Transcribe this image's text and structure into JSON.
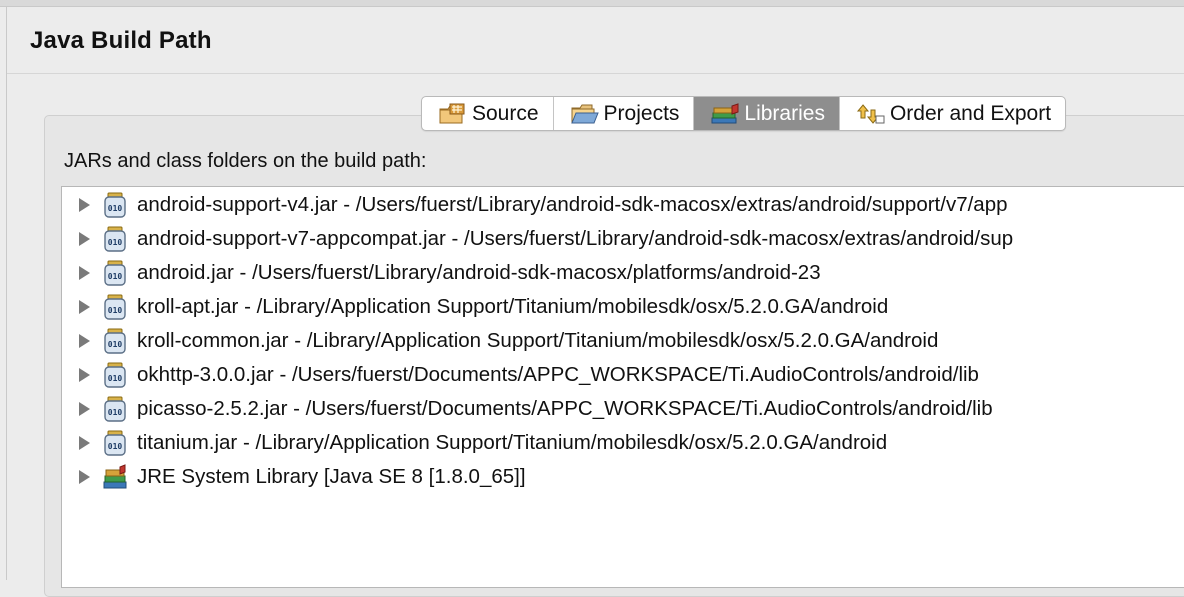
{
  "dialog": {
    "title": "Java Build Path"
  },
  "tabs": [
    {
      "label": "Source",
      "icon": "source-folder-icon",
      "active": false
    },
    {
      "label": "Projects",
      "icon": "projects-folder-icon",
      "active": false
    },
    {
      "label": "Libraries",
      "icon": "libraries-books-icon",
      "active": true
    },
    {
      "label": "Order and Export",
      "icon": "order-export-icon",
      "active": false
    }
  ],
  "libraries": {
    "section_label": "JARs and class folders on the build path:",
    "items": [
      {
        "text": "android-support-v4.jar - /Users/fuerst/Library/android-sdk-macosx/extras/android/support/v7/app",
        "icon": "jar-icon"
      },
      {
        "text": "android-support-v7-appcompat.jar - /Users/fuerst/Library/android-sdk-macosx/extras/android/sup",
        "icon": "jar-icon"
      },
      {
        "text": "android.jar - /Users/fuerst/Library/android-sdk-macosx/platforms/android-23",
        "icon": "jar-icon"
      },
      {
        "text": "kroll-apt.jar - /Library/Application Support/Titanium/mobilesdk/osx/5.2.0.GA/android",
        "icon": "jar-icon"
      },
      {
        "text": "kroll-common.jar - /Library/Application Support/Titanium/mobilesdk/osx/5.2.0.GA/android",
        "icon": "jar-icon"
      },
      {
        "text": "okhttp-3.0.0.jar - /Users/fuerst/Documents/APPC_WORKSPACE/Ti.AudioControls/android/lib",
        "icon": "jar-icon"
      },
      {
        "text": "picasso-2.5.2.jar - /Users/fuerst/Documents/APPC_WORKSPACE/Ti.AudioControls/android/lib",
        "icon": "jar-icon"
      },
      {
        "text": "titanium.jar - /Library/Application Support/Titanium/mobilesdk/osx/5.2.0.GA/android",
        "icon": "jar-icon"
      },
      {
        "text": "JRE System Library [Java SE 8 [1.8.0_65]]",
        "icon": "jre-library-icon"
      }
    ]
  },
  "colors": {
    "active_tab": "#8e8e8e",
    "background": "#ececec",
    "list_background": "#ffffff"
  }
}
